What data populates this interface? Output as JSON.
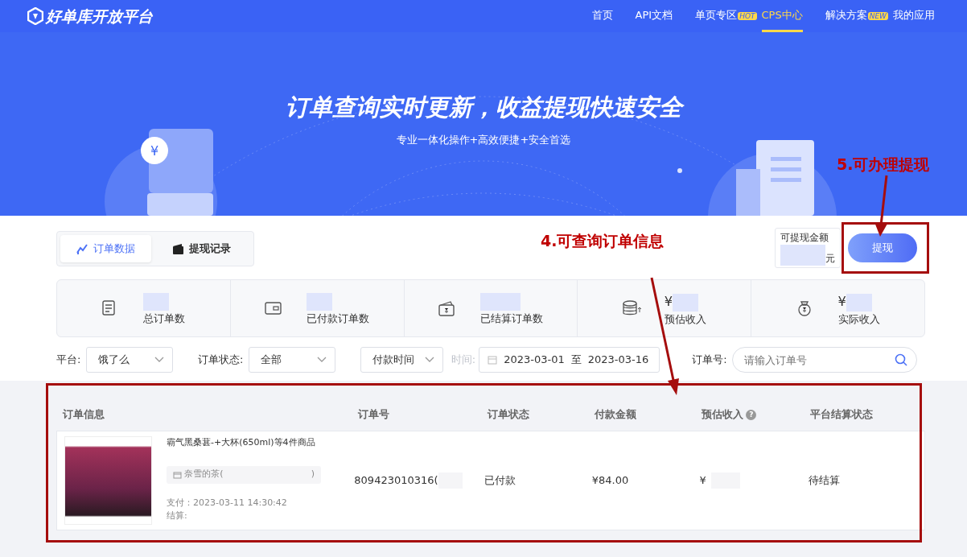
{
  "navbar": {
    "logo": "好单库开放平台",
    "items": [
      {
        "label": "首页",
        "selected": false
      },
      {
        "label": "API文档",
        "selected": false
      },
      {
        "label": "单页专区",
        "badge": "HOT",
        "selected": false
      },
      {
        "label": "CPS中心",
        "selected": true
      },
      {
        "label": "解决方案",
        "badge": "NEW",
        "selected": false
      },
      {
        "label": "我的应用",
        "selected": false
      }
    ]
  },
  "hero": {
    "title": "订单查询实时更新，收益提现快速安全",
    "subtitle": "专业一体化操作+高效便捷+安全首选",
    "coin_symbol": "¥"
  },
  "tabs": [
    {
      "label": "订单数据",
      "selected": true
    },
    {
      "label": "提现记录",
      "selected": false
    }
  ],
  "withdraw": {
    "label": "可提现金额",
    "unit": "元",
    "button": "提现"
  },
  "stats": [
    {
      "label": "总订单数"
    },
    {
      "label": "已付款订单数"
    },
    {
      "label": "已结算订单数"
    },
    {
      "label": "预估收入",
      "prefix": "¥"
    },
    {
      "label": "实际收入",
      "prefix": "¥"
    }
  ],
  "filters": {
    "platform_label": "平台:",
    "platform": "饿了么",
    "status_label": "订单状态:",
    "status": "全部",
    "time_type": "付款时间",
    "time_label": "时间:",
    "date_from": "2023-03-01",
    "date_sep": "至",
    "date_to": "2023-03-16",
    "order_label": "订单号:",
    "order_placeholder": "请输入订单号"
  },
  "table": {
    "help_symbol": "?",
    "columns": [
      {
        "label": "订单信息"
      },
      {
        "label": "订单号"
      },
      {
        "label": "订单状态"
      },
      {
        "label": "付款金额"
      },
      {
        "label": "预估收入",
        "help": true
      },
      {
        "label": "平台结算状态"
      }
    ],
    "rows": [
      {
        "title": "霸气黑桑葚-+大杯(650ml)等4件商品",
        "shop": "奈雪的茶(",
        "shop_end": ")",
        "paid": "支付：2023-03-11 14:30:42",
        "settled": "结算:",
        "order_no": "809423010316(",
        "status": "已付款",
        "amount": "¥84.00",
        "income": "¥",
        "settle_status": "待结算"
      }
    ]
  },
  "annotations": [
    {
      "text": "4.可查询订单信息"
    },
    {
      "text": "5.可办理提现"
    }
  ]
}
